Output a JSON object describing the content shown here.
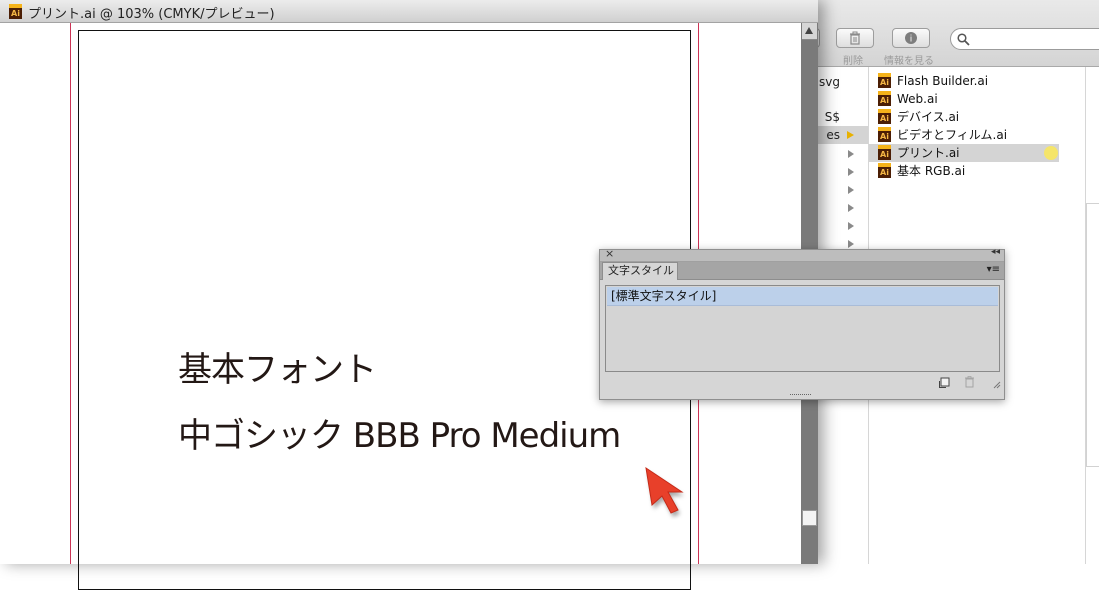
{
  "finder": {
    "toolbar": {
      "delete_label": "削除",
      "info_label": "情報を見る",
      "search_placeholder": ""
    },
    "column1_items": [
      "svg",
      "S$",
      "es",
      "",
      "",
      "",
      "",
      ""
    ],
    "files": [
      {
        "name": "Flash Builder.ai"
      },
      {
        "name": "Web.ai"
      },
      {
        "name": "デバイス.ai"
      },
      {
        "name": "ビデオとフィルム.ai"
      },
      {
        "name": "プリント.ai"
      },
      {
        "name": "基本 RGB.ai"
      }
    ],
    "selected_file_index": 4,
    "label_color": "#f5e56a"
  },
  "document": {
    "icon_text": "Ai",
    "title": "プリント.ai @ 103% (CMYK/プレビュー)",
    "artboard_text": {
      "line1": "基本フォント",
      "line2": "中ゴシック BBB Pro Medium"
    },
    "bleed_color": "#cc3355",
    "pointer_color": "#e8402a"
  },
  "panel": {
    "close_glyph": "×",
    "collapse_glyph": "◂◂",
    "tab_label": "文字スタイル",
    "menu_glyph": "▾≡",
    "items": [
      "[標準文字スタイル]"
    ],
    "selected_color": "#bcd0ea"
  }
}
